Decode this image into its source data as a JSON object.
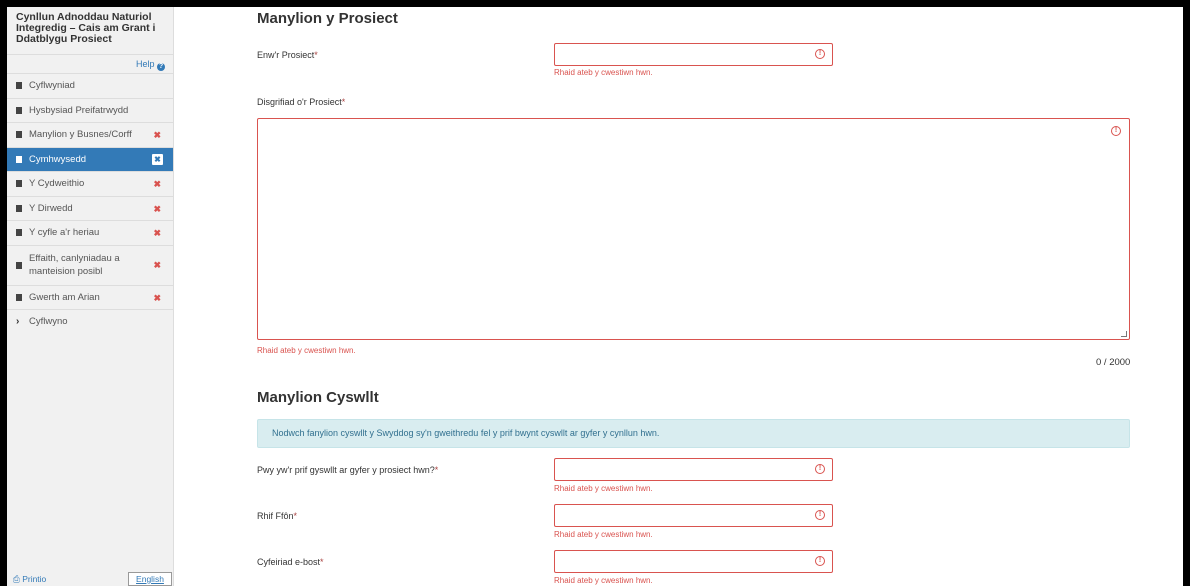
{
  "sidebar": {
    "title": "Cynllun Adnoddau Naturiol Integredig – Cais am Grant i Ddatblygu Prosiect",
    "help_label": "Help",
    "items": [
      {
        "label": "Cyflwyniad"
      },
      {
        "label": "Hysbysiad Preifatrwydd"
      },
      {
        "label": "Manylion y Busnes/Corff"
      },
      {
        "label": "Cymhwysedd"
      },
      {
        "label": "Y Cydweithio"
      },
      {
        "label": "Y Dirwedd"
      },
      {
        "label": "Y cyfle a'r heriau"
      },
      {
        "label": "Effaith, canlyniadau a manteision posibl"
      },
      {
        "label": "Gwerth am Arian"
      },
      {
        "label": "Cyflwyno"
      }
    ],
    "error_mark": "✖",
    "print_label": "Printio",
    "language_button": "English"
  },
  "main": {
    "project_section_title": "Manylion y Prosiect",
    "project_name_label": "Enw'r Prosiect",
    "project_desc_label": "Disgrifiad o'r Prosiect",
    "required_mark": "*",
    "error_message": "Rhaid ateb y cwestiwn hwn.",
    "char_counter": "0 / 2000",
    "contact_section_title": "Manylion Cyswllt",
    "contact_info": "Nodwch fanylion cyswllt y Swyddog sy'n gweithredu fel y prif bwynt cyswllt ar gyfer y cynllun hwn.",
    "contact_person_label": "Pwy yw'r prif gyswllt ar gyfer y prosiect hwn?",
    "phone_label": "Rhif Ffôn",
    "email_label": "Cyfeiriad e-bost",
    "warning_glyph": "!"
  },
  "colors": {
    "active_nav": "#337ab7",
    "error": "#d9534f",
    "info_bg": "#d9edf0"
  }
}
